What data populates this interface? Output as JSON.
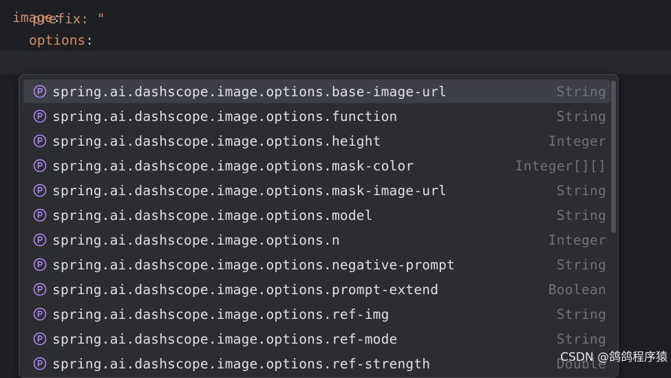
{
  "editor": {
    "partial_line": "prefix: \"",
    "line_image_key": "image",
    "line_image_colon": ":",
    "line_options_key": "options",
    "line_options_colon": ":",
    "colors": {
      "background": "#1e1f22",
      "key": "#cf8e6d"
    }
  },
  "completion_popup": {
    "items": [
      {
        "name": "spring.ai.dashscope.image.options.base-image-url",
        "type": "String",
        "icon": "property-icon",
        "selected": true
      },
      {
        "name": "spring.ai.dashscope.image.options.function",
        "type": "String",
        "icon": "property-icon"
      },
      {
        "name": "spring.ai.dashscope.image.options.height",
        "type": "Integer",
        "icon": "property-icon"
      },
      {
        "name": "spring.ai.dashscope.image.options.mask-color",
        "type": "Integer[][]",
        "icon": "property-icon"
      },
      {
        "name": "spring.ai.dashscope.image.options.mask-image-url",
        "type": "String",
        "icon": "property-icon"
      },
      {
        "name": "spring.ai.dashscope.image.options.model",
        "type": "String",
        "icon": "property-icon"
      },
      {
        "name": "spring.ai.dashscope.image.options.n",
        "type": "Integer",
        "icon": "property-icon"
      },
      {
        "name": "spring.ai.dashscope.image.options.negative-prompt",
        "type": "String",
        "icon": "property-icon"
      },
      {
        "name": "spring.ai.dashscope.image.options.prompt-extend",
        "type": "Boolean",
        "icon": "property-icon"
      },
      {
        "name": "spring.ai.dashscope.image.options.ref-img",
        "type": "String",
        "icon": "property-icon"
      },
      {
        "name": "spring.ai.dashscope.image.options.ref-mode",
        "type": "String",
        "icon": "property-icon"
      },
      {
        "name": "spring.ai.dashscope.image.options.ref-strength",
        "type": "Double",
        "icon": "property-icon"
      }
    ],
    "colors": {
      "icon": "#b189f5",
      "selected_background": "#3c3f45"
    }
  },
  "watermark": {
    "text": "CSDN @鸽鸽程序猿"
  }
}
